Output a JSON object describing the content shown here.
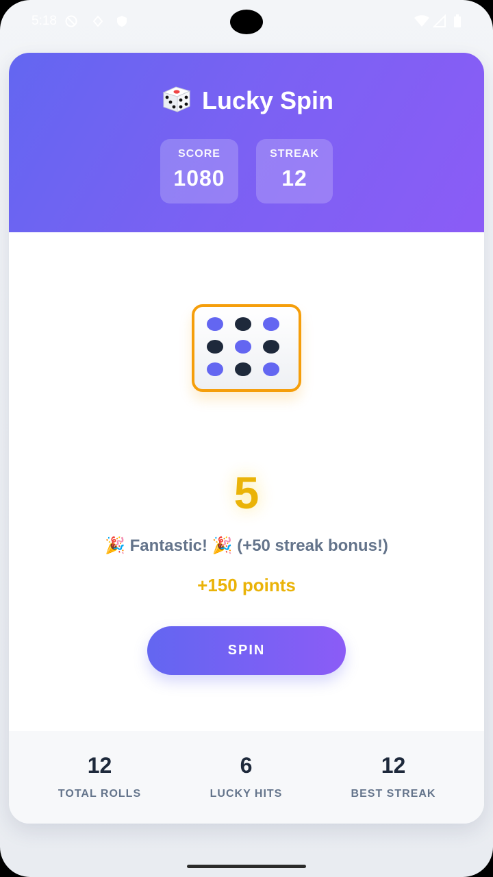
{
  "status_bar": {
    "time": "5:18",
    "icons_left": [
      "do-not-disturb-icon",
      "location-icon",
      "shield-icon"
    ],
    "icons_right": [
      "wifi-icon",
      "signal-icon",
      "battery-icon"
    ]
  },
  "header": {
    "title_emoji": "🎲",
    "title": "Lucky Spin",
    "score_label": "SCORE",
    "score_value": "1080",
    "streak_label": "STREAK",
    "streak_value": "12"
  },
  "die": {
    "pip_count": 9,
    "pip_colors": [
      "#6366f1",
      "#1e293b",
      "#6366f1",
      "#1e293b",
      "#6366f1",
      "#1e293b",
      "#6366f1",
      "#1e293b",
      "#6366f1"
    ],
    "border_color": "#f59e0b"
  },
  "result": {
    "number": "5",
    "message": "🎉 Fantastic! 🎉 (+50 streak bonus!)",
    "points": "+150 points"
  },
  "spin_button": {
    "label": "SPIN"
  },
  "footer": {
    "stats": [
      {
        "value": "12",
        "label": "TOTAL ROLLS"
      },
      {
        "value": "6",
        "label": "LUCKY HITS"
      },
      {
        "value": "12",
        "label": "BEST STREAK"
      }
    ]
  },
  "colors": {
    "accent": "#6366f1",
    "accent_secondary": "#8b5cf6",
    "gold": "#eab308",
    "text_dark": "#1e293b",
    "text_muted": "#64748b"
  }
}
